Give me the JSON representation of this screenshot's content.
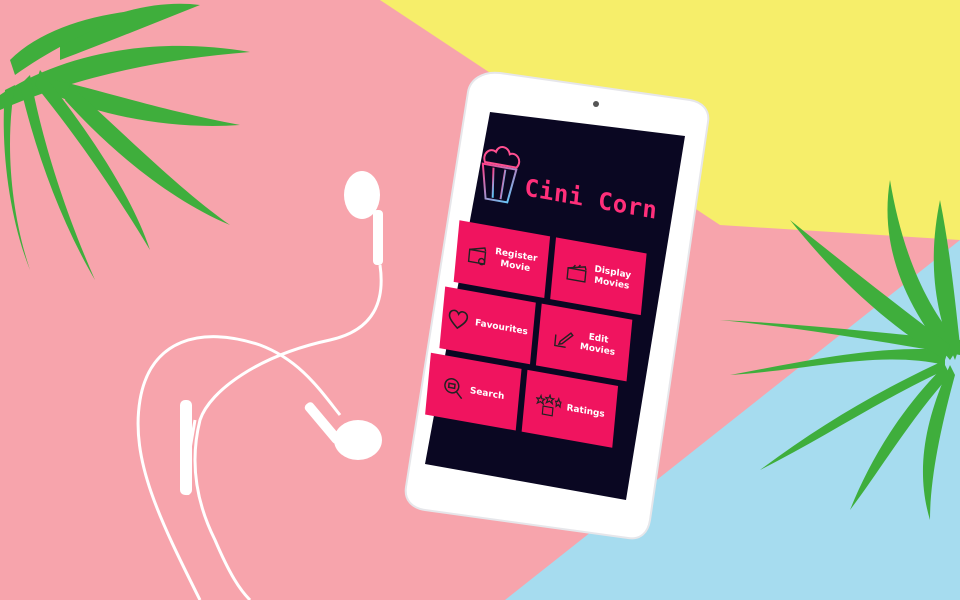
{
  "app": {
    "title": "Cini Corn",
    "logo_icon": "popcorn-bucket-icon"
  },
  "menu": [
    {
      "label": "Register\nMovie",
      "icon": "clapperboard-film-icon"
    },
    {
      "label": "Display\nMovies",
      "icon": "clapperboard-icon"
    },
    {
      "label": "Favourites",
      "icon": "heart-icon"
    },
    {
      "label": "Edit\nMovies",
      "icon": "edit-icon"
    },
    {
      "label": "Search",
      "icon": "search-icon"
    },
    {
      "label": "Ratings",
      "icon": "star-rating-icon"
    }
  ],
  "colors": {
    "screen_bg": "#0a0722",
    "tile": "#f0145f",
    "title": "#ff2f7a"
  }
}
